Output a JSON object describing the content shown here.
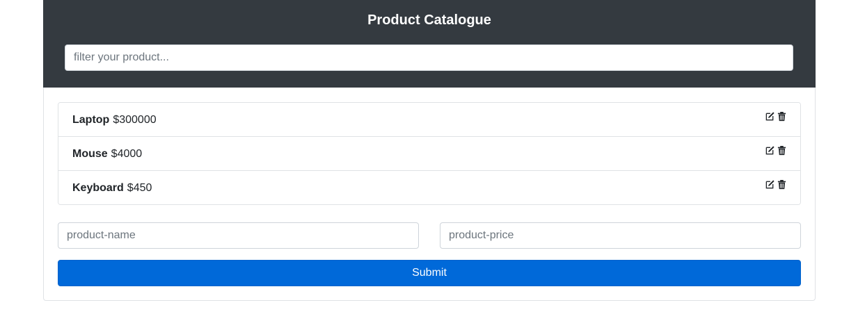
{
  "header": {
    "title": "Product Catalogue",
    "filter_placeholder": "filter your product..."
  },
  "products": [
    {
      "name": "Laptop",
      "price": "$300000"
    },
    {
      "name": "Mouse",
      "price": "$4000"
    },
    {
      "name": "Keyboard",
      "price": "$450"
    }
  ],
  "form": {
    "name_placeholder": "product-name",
    "price_placeholder": "product-price",
    "submit_label": "Submit"
  },
  "icons": {
    "edit": "edit-icon",
    "delete": "trash-icon"
  },
  "colors": {
    "header_bg": "#343a40",
    "accent": "#0069d9"
  }
}
